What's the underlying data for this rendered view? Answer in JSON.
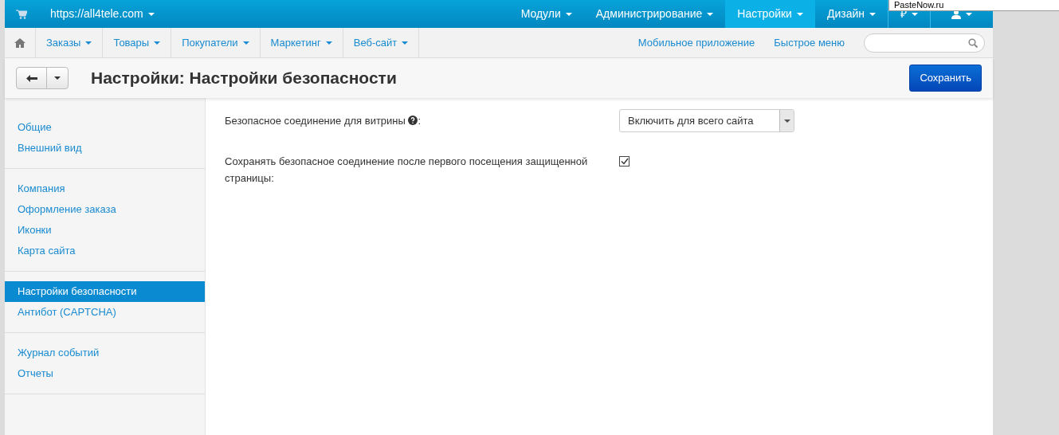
{
  "topbar": {
    "site": "https://all4tele.com",
    "menus": [
      {
        "label": "Модули",
        "selected": false
      },
      {
        "label": "Администрирование",
        "selected": false
      },
      {
        "label": "Настройки",
        "selected": true
      },
      {
        "label": "Дизайн",
        "selected": false
      },
      {
        "label": "₽",
        "selected": false
      }
    ]
  },
  "tooltip": "PasteNow.ru",
  "subnav": {
    "items": [
      "Заказы",
      "Товары",
      "Покупатели",
      "Маркетинг",
      "Веб-сайт"
    ],
    "links": [
      "Мобильное приложение",
      "Быстрое меню"
    ]
  },
  "header": {
    "title": "Настройки: Настройки безопасности",
    "save": "Сохранить"
  },
  "sidebar": {
    "groups": [
      {
        "items": [
          {
            "label": "Общие",
            "selected": false
          },
          {
            "label": "Внешний вид",
            "selected": false
          }
        ]
      },
      {
        "items": [
          {
            "label": "Компания",
            "selected": false
          },
          {
            "label": "Оформление заказа",
            "selected": false
          },
          {
            "label": "Иконки",
            "selected": false
          },
          {
            "label": "Карта сайта",
            "selected": false
          }
        ]
      },
      {
        "items": [
          {
            "label": "Настройки безопасности",
            "selected": true
          },
          {
            "label": "Антибот (CAPTCHA)",
            "selected": false
          }
        ]
      },
      {
        "items": [
          {
            "label": "Журнал событий",
            "selected": false
          },
          {
            "label": "Отчеты",
            "selected": false
          }
        ]
      }
    ]
  },
  "settings": [
    {
      "kind": "select",
      "label": "Безопасное соединение для витрины",
      "help": true,
      "suffix": ":",
      "value": "Включить для всего сайта"
    },
    {
      "kind": "checkbox",
      "label": "Сохранять безопасное соединение после первого посещения защищенной страницы:",
      "checked": true
    }
  ]
}
